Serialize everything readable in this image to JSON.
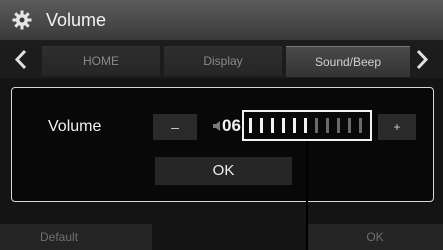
{
  "window": {
    "title": "Volume",
    "icon": "gear-icon"
  },
  "tabs": [
    {
      "label": "HOME",
      "active": false
    },
    {
      "label": "Display",
      "active": false
    },
    {
      "label": "Sound/Beep",
      "active": true
    }
  ],
  "nav": {
    "left_icon": "chevron-left-icon",
    "right_icon": "chevron-right-icon"
  },
  "volume": {
    "label": "Volume",
    "minus_label": "–",
    "plus_label": "+",
    "value": "06",
    "level": 6,
    "max_level": 11,
    "speaker_icon": "speaker-icon"
  },
  "ok_label": "OK",
  "bottom": {
    "default_label": "Default",
    "ok_label": "OK"
  },
  "colors": {
    "bar_on": "#f2f2f2",
    "bar_off": "#6a6a6a"
  }
}
